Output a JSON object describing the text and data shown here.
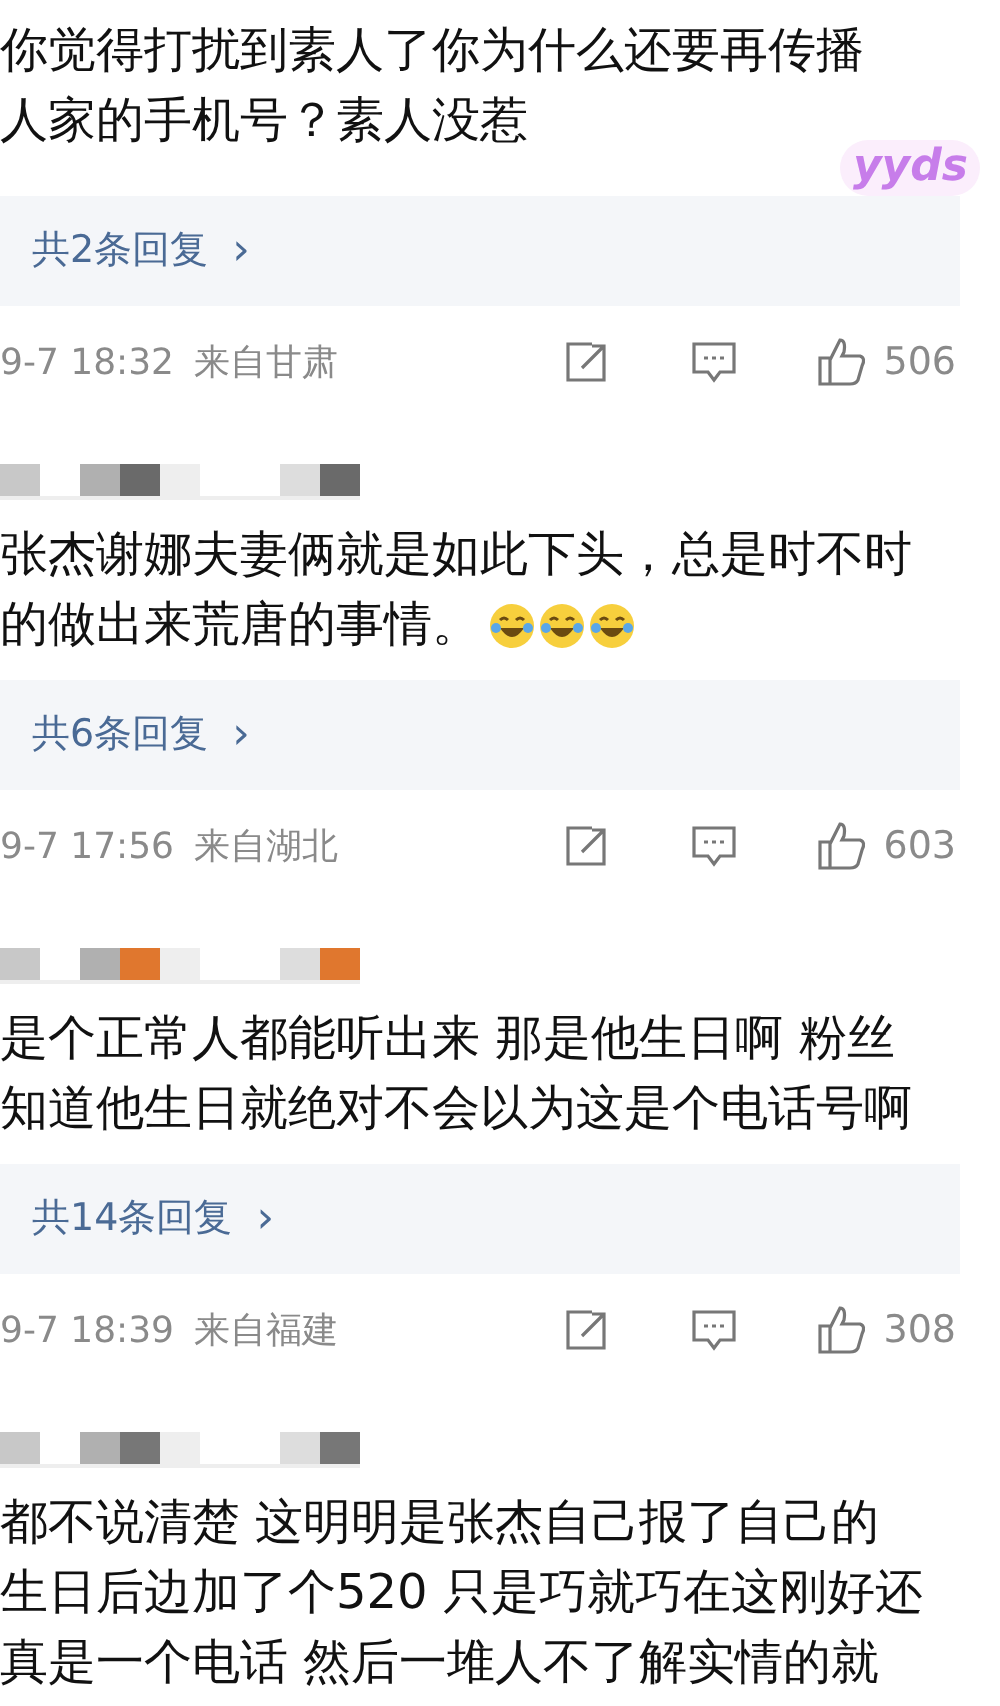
{
  "comments": [
    {
      "kind": "cut",
      "lines": [
        "你觉得打扰到素人了你为什么还要再传播",
        "人家的手机号？素人没惹"
      ],
      "sticker": "yyds",
      "replies": "共2条回复",
      "reply_arrow": "›",
      "time": "9-7 18:32",
      "location": "来自甘肃",
      "likes": "506"
    },
    {
      "kind": "full",
      "color": "#6a6a6a",
      "lines": [
        "张杰谢娜夫妻俩就是如此下头，总是时不时",
        "的做出来荒唐的事情。"
      ],
      "emojis": [
        {
          "kind": "laughing-tears"
        },
        {
          "kind": "laughing-tears"
        },
        {
          "kind": "laughing-tears"
        }
      ],
      "replies": "共6条回复",
      "reply_arrow": "›",
      "time": "9-7 17:56",
      "location": "来自湖北",
      "likes": "603"
    },
    {
      "kind": "full",
      "color": "#e0772e",
      "lines": [
        "是个正常人都能听出来 那是他生日啊 粉丝",
        "知道他生日就绝对不会以为这是个电话号啊"
      ],
      "replies": "共14条回复",
      "reply_arrow": "›",
      "time": "9-7 18:39",
      "location": "来自福建",
      "likes": "308"
    },
    {
      "kind": "full",
      "color": "#777777",
      "lines": [
        "都不说清楚 这明明是张杰自己报了自己的",
        "生日后边加了个520 只是巧就巧在这刚好还",
        "真是一个电话 然后一堆人不了解实情的就"
      ]
    }
  ]
}
